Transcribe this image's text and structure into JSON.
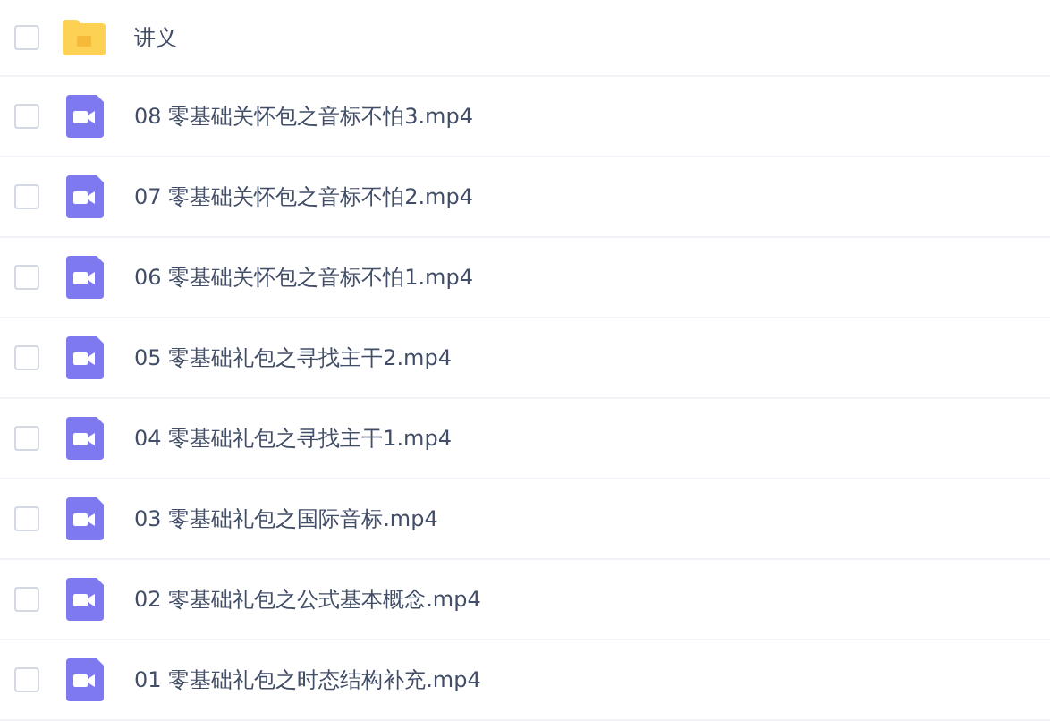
{
  "files": [
    {
      "kind": "folder",
      "name": "讲义",
      "checked": false
    },
    {
      "kind": "video",
      "name": "08 零基础关怀包之音标不怕3.mp4",
      "checked": false
    },
    {
      "kind": "video",
      "name": "07 零基础关怀包之音标不怕2.mp4",
      "checked": false
    },
    {
      "kind": "video",
      "name": "06 零基础关怀包之音标不怕1.mp4",
      "checked": false
    },
    {
      "kind": "video",
      "name": "05 零基础礼包之寻找主干2.mp4",
      "checked": false
    },
    {
      "kind": "video",
      "name": "04 零基础礼包之寻找主干1.mp4",
      "checked": false
    },
    {
      "kind": "video",
      "name": "03 零基础礼包之国际音标.mp4",
      "checked": false
    },
    {
      "kind": "video",
      "name": "02 零基础礼包之公式基本概念.mp4",
      "checked": false
    },
    {
      "kind": "video",
      "name": "01 零基础礼包之时态结构补充.mp4",
      "checked": false
    }
  ]
}
